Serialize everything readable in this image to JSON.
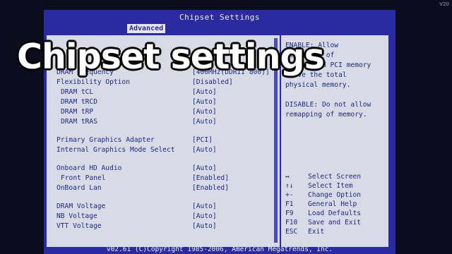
{
  "overlay_caption": "Chipset settings",
  "corner_text": "V20",
  "bios": {
    "title": "Chipset Settings",
    "active_tab": "Advanced",
    "footer": "v02.61 (C)Copyright 1985-2006, American Megatrends, Inc."
  },
  "settings": [
    {
      "label": "DRAM Frequency",
      "value": "[400MHz(DDRII 800)]",
      "indent": 0
    },
    {
      "label": "Flexibility Option",
      "value": "[Disabled]",
      "indent": 0
    },
    {
      "label": "DRAM tCL",
      "value": "[Auto]",
      "indent": 1
    },
    {
      "label": "DRAM tRCD",
      "value": "[Auto]",
      "indent": 1
    },
    {
      "label": "DRAM tRP",
      "value": "[Auto]",
      "indent": 1
    },
    {
      "label": "DRAM tRAS",
      "value": "[Auto]",
      "indent": 1
    },
    {
      "label": "Primary Graphics Adapter",
      "value": "[PCI]",
      "indent": 0
    },
    {
      "label": "Internal Graphics Mode Select",
      "value": "[Auto]",
      "indent": 0
    },
    {
      "label": "Onboard HD Audio",
      "value": "[Auto]",
      "indent": 0
    },
    {
      "label": "Front Panel",
      "value": "[Enabled]",
      "indent": 1
    },
    {
      "label": "OnBoard Lan",
      "value": "[Enabled]",
      "indent": 0
    },
    {
      "label": "DRAM Voltage",
      "value": "[Auto]",
      "indent": 0
    },
    {
      "label": "NB Voltage",
      "value": "[Auto]",
      "indent": 0
    },
    {
      "label": "VTT Voltage",
      "value": "[Auto]",
      "indent": 0
    }
  ],
  "help_text": [
    "ENABLE: Allow",
    "remapping of",
    "overlapped PCI memory",
    "above the total",
    "physical memory.",
    "",
    "DISABLE: Do not allow",
    "remapping of memory."
  ],
  "key_legend": [
    {
      "key": "↔",
      "desc": "Select Screen"
    },
    {
      "key": "↑↓",
      "desc": "Select Item"
    },
    {
      "key": "+-",
      "desc": "Change Option"
    },
    {
      "key": "F1",
      "desc": "General Help"
    },
    {
      "key": "F9",
      "desc": "Load Defaults"
    },
    {
      "key": "F10",
      "desc": "Save and Exit"
    },
    {
      "key": "ESC",
      "desc": "Exit"
    }
  ]
}
